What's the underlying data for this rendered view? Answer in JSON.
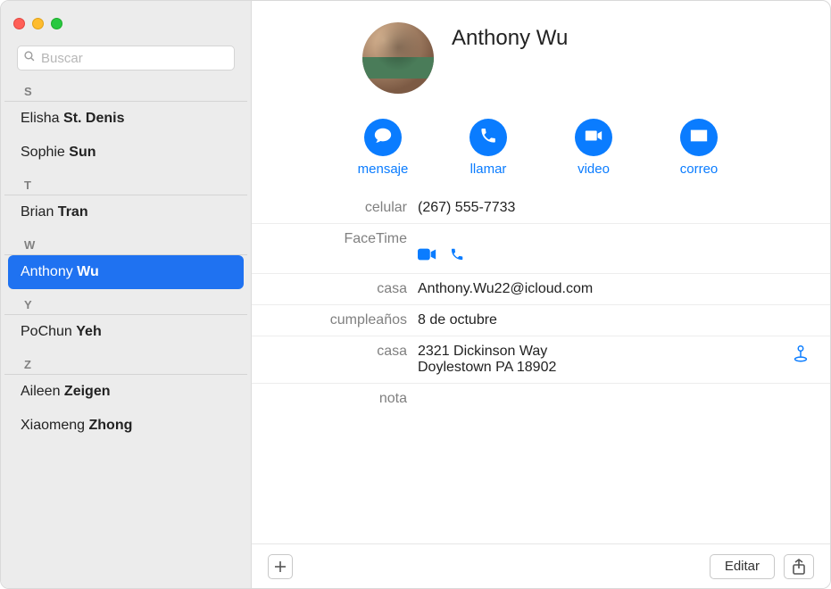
{
  "search": {
    "placeholder": "Buscar"
  },
  "sidebar": {
    "sections": [
      {
        "letter": "S",
        "items": [
          {
            "first": "Elisha",
            "last": "St. Denis"
          },
          {
            "first": "Sophie",
            "last": "Sun"
          }
        ]
      },
      {
        "letter": "T",
        "items": [
          {
            "first": "Brian",
            "last": "Tran"
          }
        ]
      },
      {
        "letter": "W",
        "items": [
          {
            "first": "Anthony",
            "last": "Wu",
            "selected": true
          }
        ]
      },
      {
        "letter": "Y",
        "items": [
          {
            "first": "PoChun",
            "last": "Yeh"
          }
        ]
      },
      {
        "letter": "Z",
        "items": [
          {
            "first": "Aileen",
            "last": "Zeigen"
          },
          {
            "first": "Xiaomeng",
            "last": "Zhong"
          }
        ]
      }
    ]
  },
  "contact": {
    "name": "Anthony Wu",
    "actions": {
      "message": "mensaje",
      "call": "llamar",
      "video": "video",
      "mail": "correo"
    },
    "fields": {
      "cell_label": "celular",
      "cell_value": "(267) 555-7733",
      "facetime_label": "FaceTime",
      "home_email_label": "casa",
      "home_email_value": "Anthony.Wu22@icloud.com",
      "birthday_label": "cumpleaños",
      "birthday_value": "8 de octubre",
      "home_addr_label": "casa",
      "home_addr_value": "2321 Dickinson Way\nDoylestown PA 18902",
      "note_label": "nota"
    }
  },
  "toolbar": {
    "edit": "Editar"
  }
}
